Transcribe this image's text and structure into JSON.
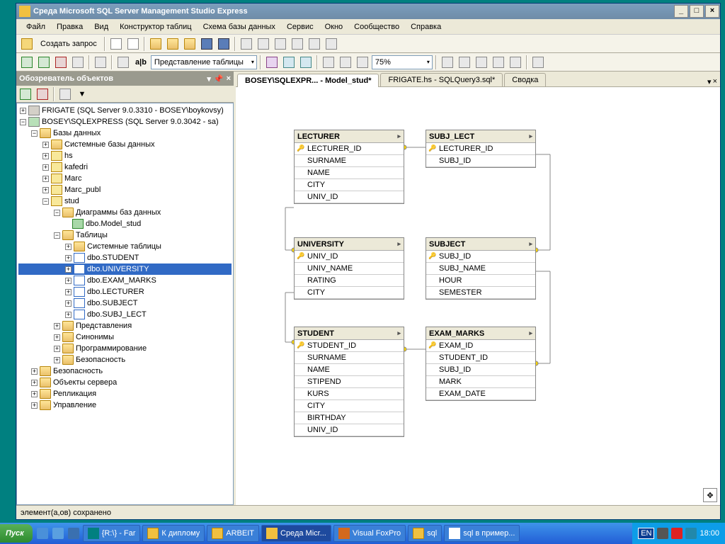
{
  "window": {
    "title": "Среда Microsoft SQL Server Management Studio Express"
  },
  "menu": [
    "Файл",
    "Правка",
    "Вид",
    "Конструктор таблиц",
    "Схема базы данных",
    "Сервис",
    "Окно",
    "Сообщество",
    "Справка"
  ],
  "toolbar1": {
    "newquery": "Создать запрос"
  },
  "toolbar2": {
    "viewcombo": "Представление таблицы",
    "zoom": "75%"
  },
  "objexplorer": {
    "title": "Обозреватель объектов",
    "root1": "FRIGATE (SQL Server 9.0.3310 - BOSEY\\boykovsy)",
    "root2": "BOSEY\\SQLEXPRESS (SQL Server 9.0.3042 - sa)",
    "databases": "Базы данных",
    "sysdb": "Системные базы данных",
    "db_hs": "hs",
    "db_kaf": "kafedri",
    "db_marc": "Marc",
    "db_marcp": "Marc_publ",
    "db_stud": "stud",
    "dbdiag": "Диаграммы баз данных",
    "diag1": "dbo.Model_stud",
    "tables": "Таблицы",
    "systables": "Системные таблицы",
    "t_student": "dbo.STUDENT",
    "t_univ": "dbo.UNIVERSITY",
    "t_exam": "dbo.EXAM_MARKS",
    "t_lect": "dbo.LECTURER",
    "t_subj": "dbo.SUBJECT",
    "t_sl": "dbo.SUBJ_LECT",
    "views": "Представления",
    "syn": "Синонимы",
    "prog": "Программирование",
    "sec": "Безопасность",
    "sec2": "Безопасность",
    "srvobj": "Объекты сервера",
    "repl": "Репликация",
    "mgmt": "Управление"
  },
  "tabs": {
    "t1": "BOSEY\\SQLEXPR... - Model_stud*",
    "t2": "FRIGATE.hs - SQLQuery3.sql*",
    "t3": "Сводка"
  },
  "entities": {
    "lecturer": {
      "title": "LECTURER",
      "cols": [
        "LECTURER_ID",
        "SURNAME",
        "NAME",
        "CITY",
        "UNIV_ID"
      ]
    },
    "subj_lect": {
      "title": "SUBJ_LECT",
      "cols": [
        "LECTURER_ID",
        "SUBJ_ID"
      ]
    },
    "university": {
      "title": "UNIVERSITY",
      "cols": [
        "UNIV_ID",
        "UNIV_NAME",
        "RATING",
        "CITY"
      ]
    },
    "subject": {
      "title": "SUBJECT",
      "cols": [
        "SUBJ_ID",
        "SUBJ_NAME",
        "HOUR",
        "SEMESTER"
      ]
    },
    "student": {
      "title": "STUDENT",
      "cols": [
        "STUDENT_ID",
        "SURNAME",
        "NAME",
        "STIPEND",
        "KURS",
        "CITY",
        "BIRTHDAY",
        "UNIV_ID"
      ]
    },
    "exam_marks": {
      "title": "EXAM_MARKS",
      "cols": [
        "EXAM_ID",
        "STUDENT_ID",
        "SUBJ_ID",
        "MARK",
        "EXAM_DATE"
      ]
    }
  },
  "status": "элемент(а,ов) сохранено",
  "taskbar": {
    "start": "Пуск",
    "items": [
      "{R:\\} - Far",
      "К диплому",
      "ARBEIT",
      "Среда Micr...",
      "Visual FoxPro",
      "sql",
      "sql в пример..."
    ],
    "time": "18:00",
    "lang": "EN"
  }
}
